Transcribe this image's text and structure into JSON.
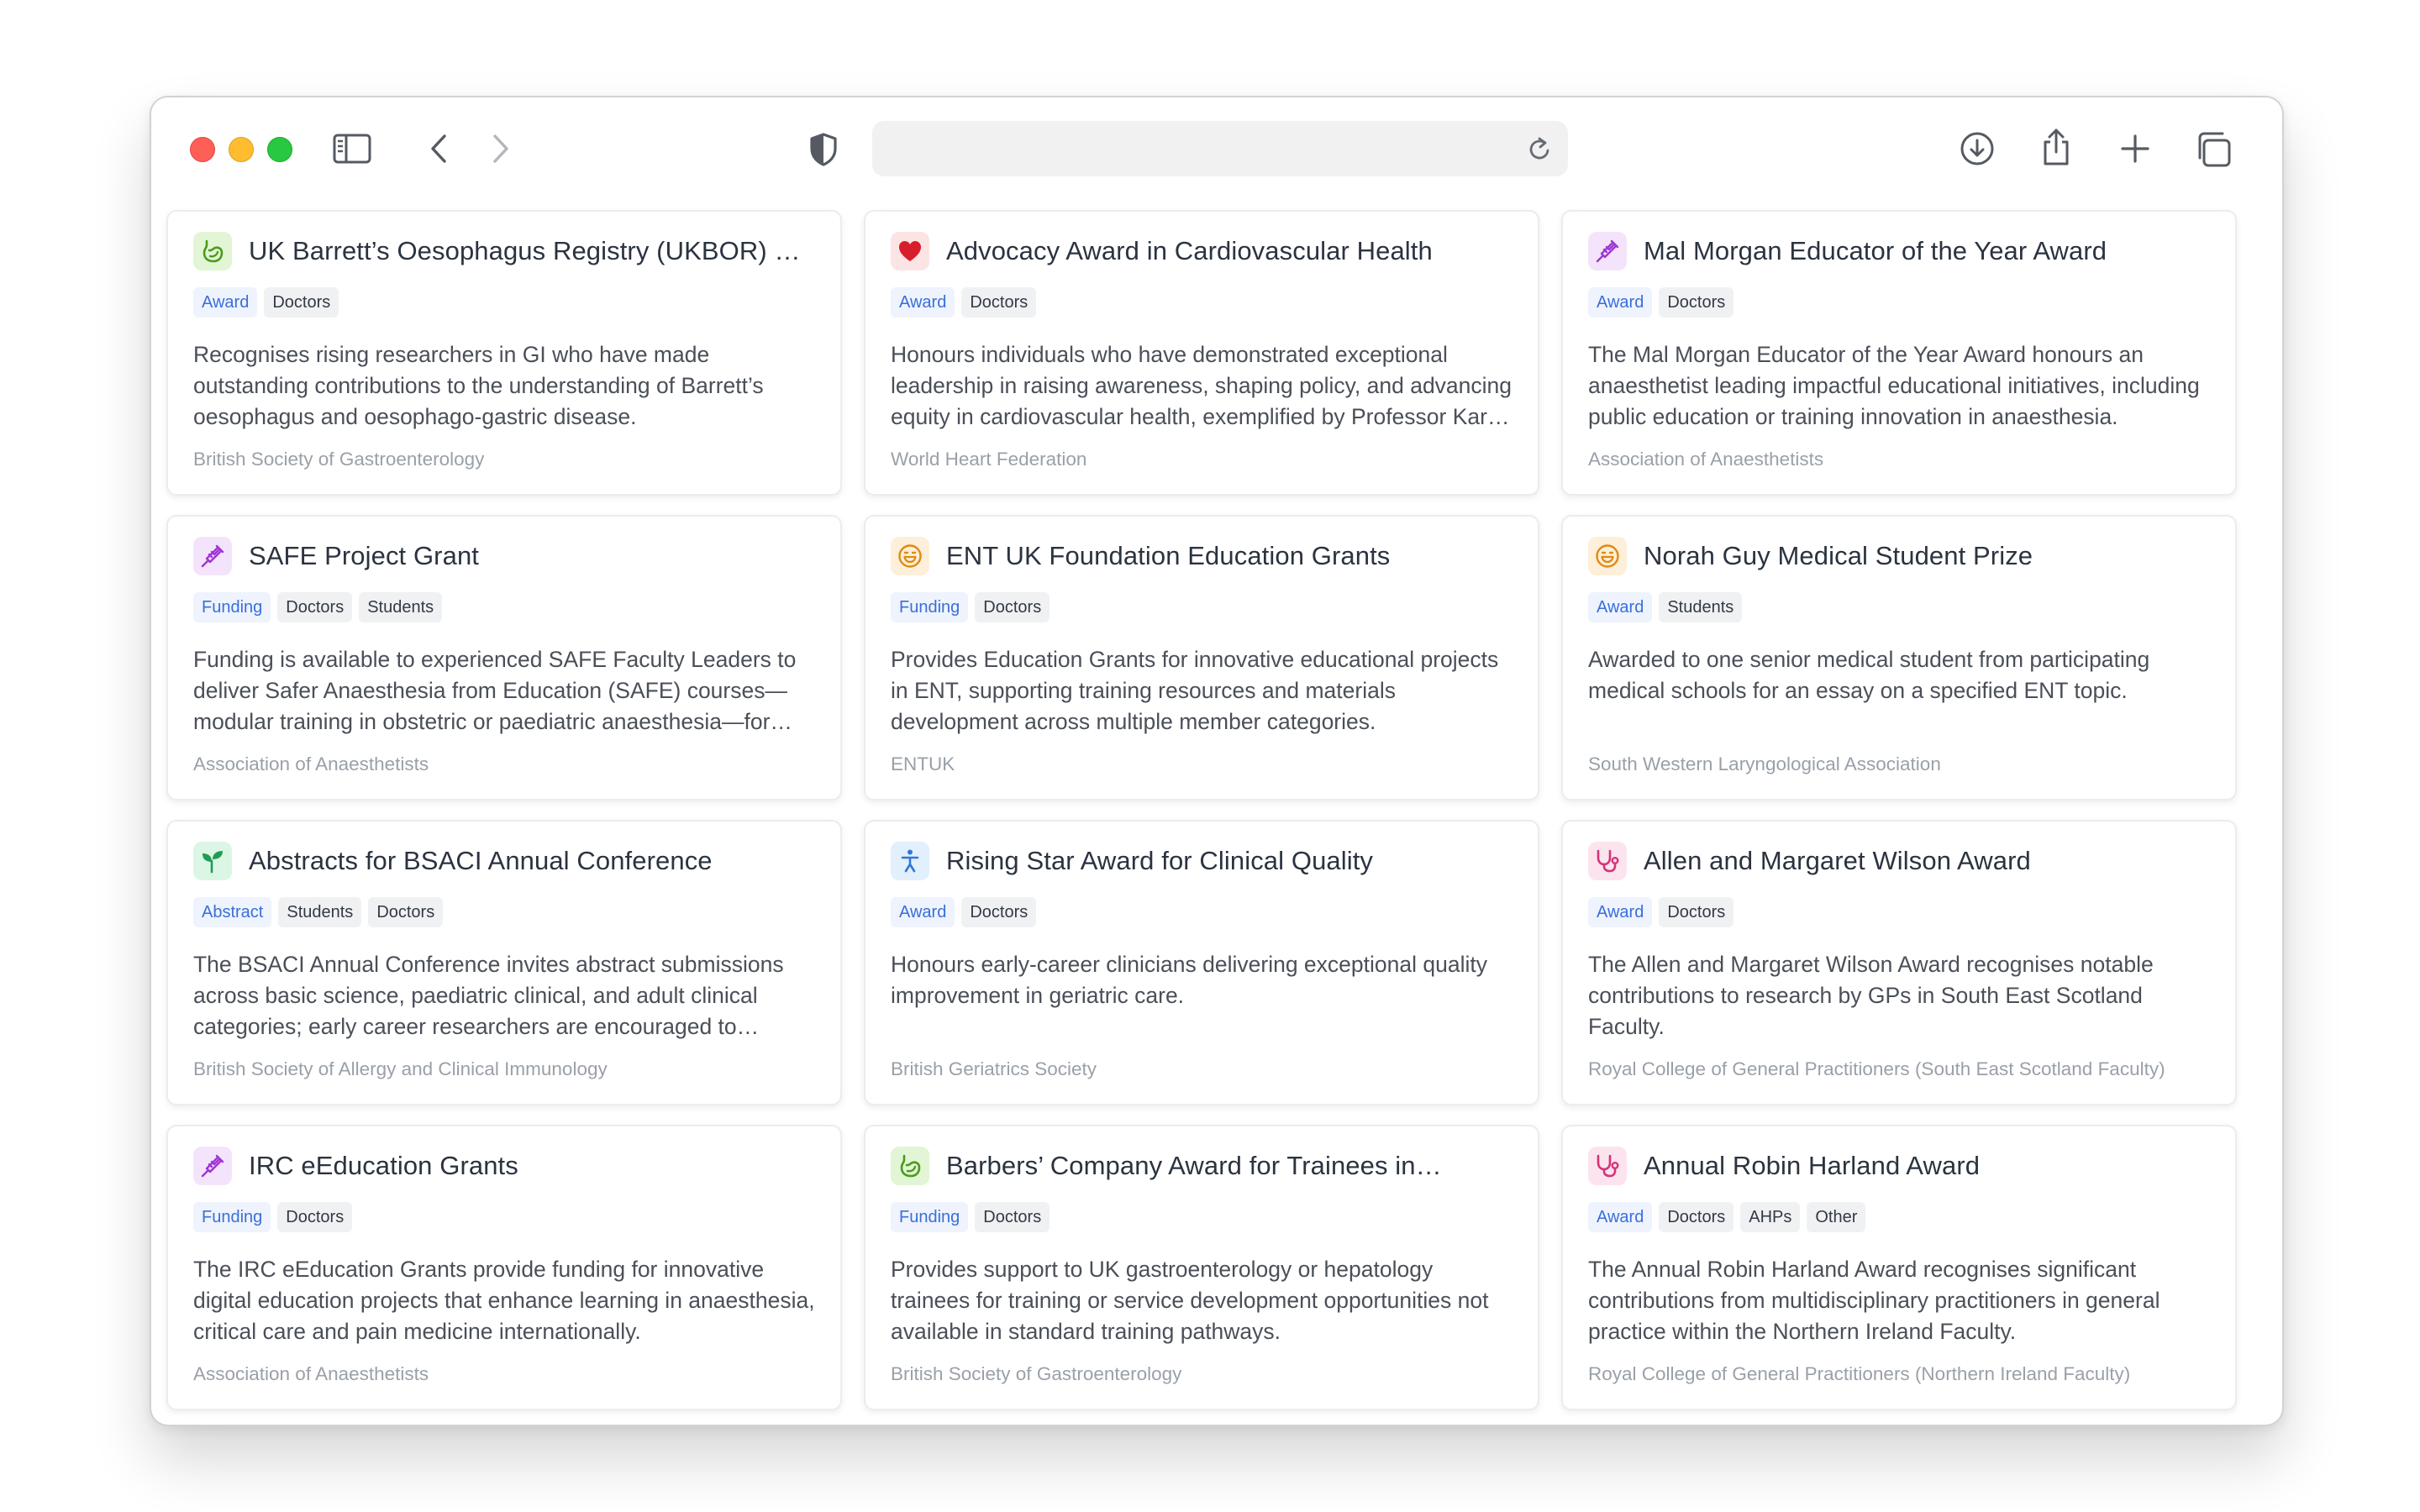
{
  "browser": {
    "toolbar_icons": [
      "sidebar-icon",
      "back-icon",
      "forward-icon",
      "shield-icon",
      "reload-icon",
      "download-icon",
      "share-icon",
      "new-tab-icon",
      "tabs-overview-icon"
    ],
    "url": ""
  },
  "colors": {
    "type_tag_bg": "#eef3fd",
    "type_tag_text": "#3a6fd8",
    "audience_tag_bg": "#f0f1f3"
  },
  "cards": [
    {
      "title": "UK Barrett’s Oesophagus Registry (UKBOR) Prize",
      "icon": "stomach-icon",
      "icon_bg": "#e2f5d4",
      "icon_color": "#4a9b1c",
      "tags": [
        {
          "label": "Award",
          "kind": "type"
        },
        {
          "label": "Doctors",
          "kind": "audience"
        }
      ],
      "description": "Recognises rising researchers in GI who have made outstanding contributions to the understanding of Barrett’s oesophagus and oesophago-gastric disease.",
      "organisation": "British Society of Gastroenterology"
    },
    {
      "title": "Advocacy Award in Cardiovascular Health",
      "icon": "heart-icon",
      "icon_bg": "#fde4e4",
      "icon_color": "#d81e2c",
      "tags": [
        {
          "label": "Award",
          "kind": "type"
        },
        {
          "label": "Doctors",
          "kind": "audience"
        }
      ],
      "description": "Honours individuals who have demonstrated exceptional leadership in raising awareness, shaping policy, and advancing equity in cardiovascular health, exemplified by Professor Kar…",
      "organisation": "World Heart Federation"
    },
    {
      "title": "Mal Morgan Educator of the Year Award",
      "icon": "syringe-icon",
      "icon_bg": "#f4e4fb",
      "icon_color": "#a034d6",
      "tags": [
        {
          "label": "Award",
          "kind": "type"
        },
        {
          "label": "Doctors",
          "kind": "audience"
        }
      ],
      "description": "The Mal Morgan Educator of the Year Award honours an anaesthetist leading impactful educational initiatives, including public education or training innovation in anaesthesia.",
      "organisation": "Association of Anaesthetists"
    },
    {
      "title": "SAFE Project Grant",
      "icon": "syringe-icon",
      "icon_bg": "#f4e4fb",
      "icon_color": "#a034d6",
      "tags": [
        {
          "label": "Funding",
          "kind": "type"
        },
        {
          "label": "Doctors",
          "kind": "audience"
        },
        {
          "label": "Students",
          "kind": "audience"
        }
      ],
      "description": "Funding is available to experienced SAFE Faculty Leaders to deliver Safer Anaesthesia from Education (SAFE) courses—modular training in obstetric or paediatric anaesthesia—for…",
      "organisation": "Association of Anaesthetists"
    },
    {
      "title": "ENT UK Foundation Education Grants",
      "icon": "ear-face-icon",
      "icon_bg": "#fdefd9",
      "icon_color": "#e08a12",
      "tags": [
        {
          "label": "Funding",
          "kind": "type"
        },
        {
          "label": "Doctors",
          "kind": "audience"
        }
      ],
      "description": "Provides Education Grants for innovative educational projects in ENT, supporting training resources and materials development across multiple member categories.",
      "organisation": "ENTUK"
    },
    {
      "title": "Norah Guy Medical Student Prize",
      "icon": "ear-face-icon",
      "icon_bg": "#fdefd9",
      "icon_color": "#e08a12",
      "tags": [
        {
          "label": "Award",
          "kind": "type"
        },
        {
          "label": "Students",
          "kind": "audience"
        }
      ],
      "description": "Awarded to one senior medical student from participating medical schools for an essay on a specified ENT topic.",
      "organisation": "South Western Laryngological Association"
    },
    {
      "title": "Abstracts for BSACI Annual Conference",
      "icon": "sprout-icon",
      "icon_bg": "#dcf6e6",
      "icon_color": "#1f9d55",
      "tags": [
        {
          "label": "Abstract",
          "kind": "type"
        },
        {
          "label": "Students",
          "kind": "audience"
        },
        {
          "label": "Doctors",
          "kind": "audience"
        }
      ],
      "description": "The BSACI Annual Conference invites abstract submissions across basic science, paediatric clinical, and adult clinical categories; early career researchers are encouraged to…",
      "organisation": "British Society of Allergy and Clinical Immunology"
    },
    {
      "title": "Rising Star Award for Clinical Quality",
      "icon": "person-walking-icon",
      "icon_bg": "#e2effd",
      "icon_color": "#2f78d6",
      "tags": [
        {
          "label": "Award",
          "kind": "type"
        },
        {
          "label": "Doctors",
          "kind": "audience"
        }
      ],
      "description": "Honours early-career clinicians delivering exceptional quality improvement in geriatric care.",
      "organisation": "British Geriatrics Society"
    },
    {
      "title": "Allen and Margaret Wilson Award",
      "icon": "stethoscope-icon",
      "icon_bg": "#fce4ef",
      "icon_color": "#d6327a",
      "tags": [
        {
          "label": "Award",
          "kind": "type"
        },
        {
          "label": "Doctors",
          "kind": "audience"
        }
      ],
      "description": "The Allen and Margaret Wilson Award recognises notable contributions to research by GPs in South East Scotland Faculty.",
      "organisation": "Royal College of General Practitioners (South East Scotland Faculty)"
    },
    {
      "title": "IRC eEducation Grants",
      "icon": "syringe-icon",
      "icon_bg": "#f4e4fb",
      "icon_color": "#a034d6",
      "tags": [
        {
          "label": "Funding",
          "kind": "type"
        },
        {
          "label": "Doctors",
          "kind": "audience"
        }
      ],
      "description": "The IRC eEducation Grants provide funding for innovative digital education projects that enhance learning in anaesthesia, critical care and pain medicine internationally.",
      "organisation": "Association of Anaesthetists"
    },
    {
      "title": "Barbers’ Company Award for Trainees in…",
      "icon": "stomach-icon",
      "icon_bg": "#e2f5d4",
      "icon_color": "#4a9b1c",
      "tags": [
        {
          "label": "Funding",
          "kind": "type"
        },
        {
          "label": "Doctors",
          "kind": "audience"
        }
      ],
      "description": "Provides support to UK gastroenterology or hepatology trainees for training or service development opportunities not available in standard training pathways.",
      "organisation": "British Society of Gastroenterology"
    },
    {
      "title": "Annual Robin Harland Award",
      "icon": "stethoscope-icon",
      "icon_bg": "#fce4ef",
      "icon_color": "#d6327a",
      "tags": [
        {
          "label": "Award",
          "kind": "type"
        },
        {
          "label": "Doctors",
          "kind": "audience"
        },
        {
          "label": "AHPs",
          "kind": "audience"
        },
        {
          "label": "Other",
          "kind": "audience"
        }
      ],
      "description": "The Annual Robin Harland Award recognises significant contributions from multidisciplinary practitioners in general practice within the Northern Ireland Faculty.",
      "organisation": "Royal College of General Practitioners (Northern Ireland Faculty)"
    }
  ]
}
